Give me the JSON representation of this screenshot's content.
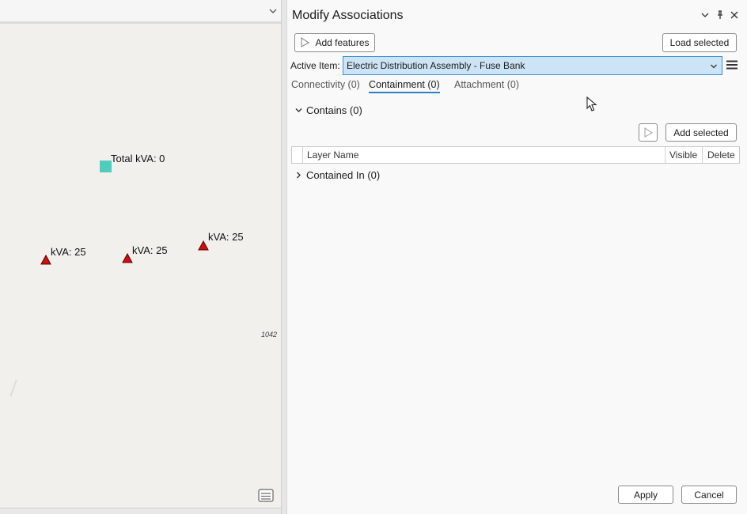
{
  "map": {
    "labels": {
      "total": "Total kVA: 0",
      "kva1": "kVA: 25",
      "kva2": "kVA: 25",
      "kva3": "kVA: 25",
      "small": "1042"
    },
    "colors": {
      "square": "#4ecdbd",
      "triangle": "#cc1111"
    },
    "icons": {
      "collapse": "chevron-down-icon",
      "tool": "layers-tool-icon"
    }
  },
  "panel": {
    "title": "Modify Associations",
    "controls": {
      "options": "chevron-down-icon",
      "pin": "pin-icon",
      "close": "close-icon"
    },
    "add_features": "Add features",
    "load_selected": "Load selected",
    "active_item_label": "Active Item:",
    "active_item_value": "Electric Distribution Assembly - Fuse Bank",
    "tabs": [
      {
        "label": "Connectivity (0)",
        "active": false
      },
      {
        "label": "Containment (0)",
        "active": true
      },
      {
        "label": "Attachment (0)",
        "active": false
      }
    ],
    "contains": "Contains (0)",
    "add_selected": "Add selected",
    "grid_headers": [
      "Layer Name",
      "Visible",
      "Delete"
    ],
    "contained_in": "Contained In (0)",
    "apply": "Apply",
    "cancel": "Cancel",
    "accent": "#2f7fc1"
  }
}
